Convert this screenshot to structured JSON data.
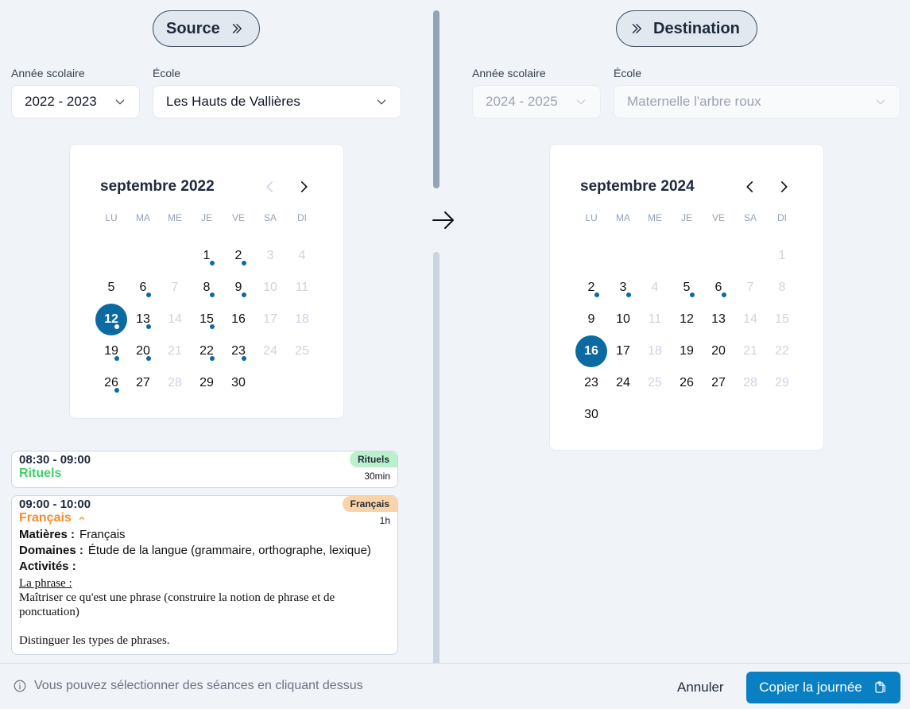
{
  "source": {
    "pill_label": "Source",
    "year_label": "Année scolaire",
    "year_value": "2022 - 2023",
    "school_label": "École",
    "school_value": "Les Hauts de Vallières",
    "calendar": {
      "title": "septembre 2022",
      "weekdays": [
        "LU",
        "MA",
        "ME",
        "JE",
        "VE",
        "SA",
        "DI"
      ],
      "days": [
        {
          "n": ""
        },
        {
          "n": ""
        },
        {
          "n": ""
        },
        {
          "n": "1",
          "dot": true
        },
        {
          "n": "2",
          "dot": true
        },
        {
          "n": "3",
          "muted": true
        },
        {
          "n": "4",
          "muted": true
        },
        {
          "n": "5"
        },
        {
          "n": "6",
          "dot": true
        },
        {
          "n": "7",
          "muted": true
        },
        {
          "n": "8",
          "dot": true
        },
        {
          "n": "9",
          "dot": true
        },
        {
          "n": "10",
          "muted": true
        },
        {
          "n": "11",
          "muted": true
        },
        {
          "n": "12",
          "dot": true,
          "selected": true
        },
        {
          "n": "13",
          "dot": true
        },
        {
          "n": "14",
          "muted": true
        },
        {
          "n": "15",
          "dot": true
        },
        {
          "n": "16"
        },
        {
          "n": "17",
          "muted": true
        },
        {
          "n": "18",
          "muted": true
        },
        {
          "n": "19",
          "dot": true
        },
        {
          "n": "20",
          "dot": true
        },
        {
          "n": "21",
          "muted": true
        },
        {
          "n": "22",
          "dot": true
        },
        {
          "n": "23",
          "dot": true
        },
        {
          "n": "24",
          "muted": true
        },
        {
          "n": "25",
          "muted": true
        },
        {
          "n": "26",
          "dot": true
        },
        {
          "n": "27"
        },
        {
          "n": "28",
          "muted": true
        },
        {
          "n": "29"
        },
        {
          "n": "30"
        }
      ]
    }
  },
  "destination": {
    "pill_label": "Destination",
    "year_label": "Année scolaire",
    "year_value": "2024 - 2025",
    "school_label": "École",
    "school_value": "Maternelle l'arbre roux",
    "calendar": {
      "title": "septembre 2024",
      "weekdays": [
        "LU",
        "MA",
        "ME",
        "JE",
        "VE",
        "SA",
        "DI"
      ],
      "days": [
        {
          "n": ""
        },
        {
          "n": ""
        },
        {
          "n": ""
        },
        {
          "n": ""
        },
        {
          "n": ""
        },
        {
          "n": ""
        },
        {
          "n": "1",
          "muted": true
        },
        {
          "n": "2",
          "dot": true
        },
        {
          "n": "3",
          "dot": true
        },
        {
          "n": "4",
          "muted": true
        },
        {
          "n": "5",
          "dot": true
        },
        {
          "n": "6",
          "dot": true
        },
        {
          "n": "7",
          "muted": true
        },
        {
          "n": "8",
          "muted": true
        },
        {
          "n": "9"
        },
        {
          "n": "10"
        },
        {
          "n": "11",
          "muted": true
        },
        {
          "n": "12"
        },
        {
          "n": "13"
        },
        {
          "n": "14",
          "muted": true
        },
        {
          "n": "15",
          "muted": true
        },
        {
          "n": "16",
          "selected": true
        },
        {
          "n": "17"
        },
        {
          "n": "18",
          "muted": true
        },
        {
          "n": "19"
        },
        {
          "n": "20"
        },
        {
          "n": "21",
          "muted": true
        },
        {
          "n": "22",
          "muted": true
        },
        {
          "n": "23"
        },
        {
          "n": "24"
        },
        {
          "n": "25",
          "muted": true
        },
        {
          "n": "26"
        },
        {
          "n": "27"
        },
        {
          "n": "28",
          "muted": true
        },
        {
          "n": "29",
          "muted": true
        },
        {
          "n": "30"
        }
      ]
    }
  },
  "sessions": [
    {
      "time": "08:30 - 09:00",
      "title": "Rituels",
      "title_color": "#3fce6c",
      "badge": "Rituels",
      "badge_color": "#bbf0cc",
      "duration": "30min"
    },
    {
      "time": "09:00 - 10:00",
      "title": "Français",
      "title_color": "#f58c2e",
      "badge": "Français",
      "badge_color": "#fad4a6",
      "duration": "1h",
      "matieres_label": "Matières :",
      "matieres_value": "Français",
      "domaines_label": "Domaines :",
      "domaines_value": "Étude de la langue (grammaire, orthographe, lexique)",
      "activites_label": "Activités :",
      "activity_heading": "La phrase :",
      "activity_line1": "Maîtriser ce qu'est une phrase (construire la notion de phrase et de ponctuation)",
      "activity_line2": "Distinguer les types de phrases."
    }
  ],
  "footer": {
    "info_text": "Vous pouvez sélectionner des séances en cliquant dessus",
    "cancel_label": "Annuler",
    "copy_label": "Copier la journée"
  },
  "colors": {
    "accent": "#0a6aa1",
    "primary_button": "#0a80c4"
  }
}
